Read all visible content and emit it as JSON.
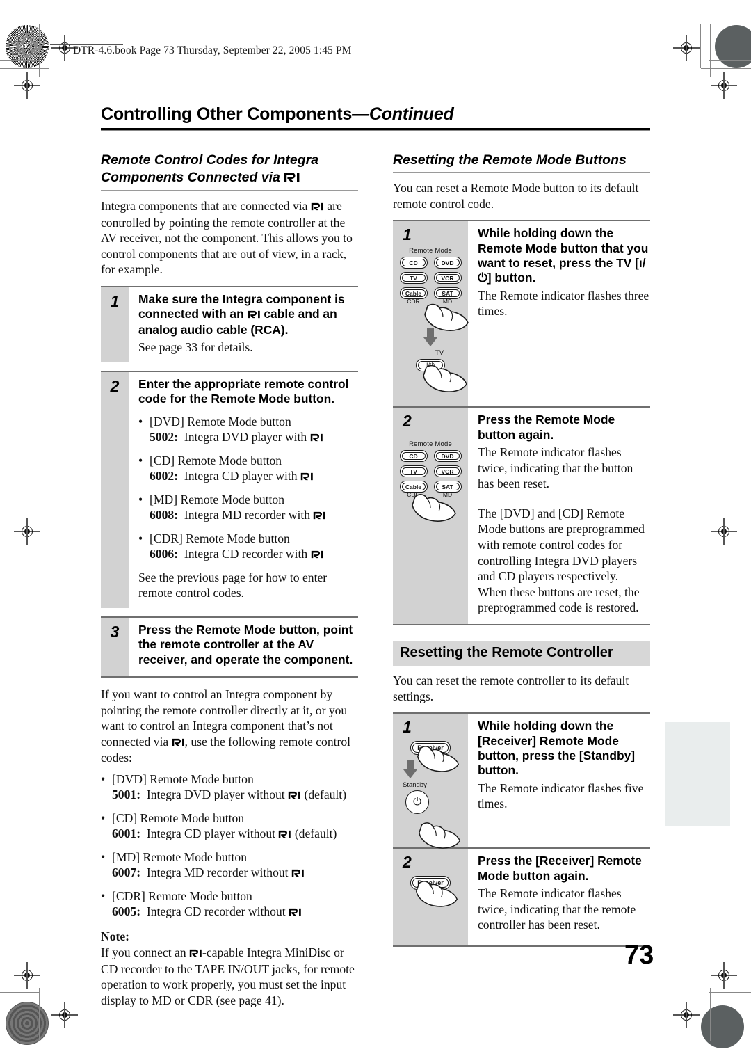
{
  "file_stamp": "DTR-4.6.book  Page 73  Thursday, September 22, 2005  1:45 PM",
  "running_head": {
    "title": "Controlling Other Components",
    "continued": "—Continued"
  },
  "page_number": "73",
  "left_column": {
    "subhead_line1": "Remote Control Codes for Integra",
    "subhead_line2_pre": "Components Connected via ",
    "intro": "Integra components that are connected via  are controlled by pointing the remote controller at the AV receiver, not the component. This allows you to control components that are out of view, in a rack, for example.",
    "steps": [
      {
        "num": "1",
        "title": "Make sure the Integra component is connected with an  cable and an analog audio cable (RCA).",
        "sub": "See page 33 for details."
      },
      {
        "num": "2",
        "title": "Enter the appropriate remote control code for the Remote Mode button.",
        "sub": ""
      },
      {
        "num": "3",
        "title": "Press the Remote Mode button, point the remote controller at the AV receiver, and operate the component.",
        "sub": ""
      }
    ],
    "codes_with_ri": [
      {
        "label": "[DVD] Remote Mode button",
        "code": "5002:",
        "desc_pre": "Integra DVD player with ",
        "desc_post": ""
      },
      {
        "label": "[CD] Remote Mode button",
        "code": "6002:",
        "desc_pre": "Integra CD player with ",
        "desc_post": ""
      },
      {
        "label": "[MD] Remote Mode button",
        "code": "6008:",
        "desc_pre": "Integra MD recorder with ",
        "desc_post": ""
      },
      {
        "label": "[CDR] Remote Mode button",
        "code": "6006:",
        "desc_pre": "Integra CD recorder with ",
        "desc_post": ""
      }
    ],
    "after_codes": "See the previous page for how to enter remote control codes.",
    "para_after_step3": "If you want to control an Integra component by pointing the remote controller directly at it, or you want to control an Integra component that’s not connected via , use the following remote control codes:",
    "codes_without_ri": [
      {
        "label": "[DVD] Remote Mode button",
        "code": "5001:",
        "desc_pre": "Integra DVD player without ",
        "desc_post": " (default)"
      },
      {
        "label": "[CD] Remote Mode button",
        "code": "6001:",
        "desc_pre": "Integra CD player without ",
        "desc_post": " (default)"
      },
      {
        "label": "[MD] Remote Mode button",
        "code": "6007:",
        "desc_pre": "Integra MD recorder without ",
        "desc_post": ""
      },
      {
        "label": "[CDR] Remote Mode button",
        "code": "6005:",
        "desc_pre": "Integra CD recorder without ",
        "desc_post": ""
      }
    ],
    "note_title": "Note:",
    "note_pre": "If you connect an ",
    "note_post": "-capable Integra MiniDisc or CD recorder to the TAPE IN/OUT jacks, for remote operation to work properly, you must set the input display to MD or CDR (see page 41)."
  },
  "right_column": {
    "section1": {
      "subhead": "Resetting the Remote Mode Buttons",
      "intro": "You can reset a Remote Mode button to its default remote control code.",
      "steps": [
        {
          "num": "1",
          "title": "While holding down the Remote Mode button that you want to reset, press the TV [ı/⏻] button.",
          "body": "The Remote indicator flashes three times."
        },
        {
          "num": "2",
          "title": "Press the Remote Mode button again.",
          "body": "The Remote indicator flashes twice, indicating that the button has been reset.",
          "body2": "The [DVD] and [CD] Remote Mode buttons are preprogrammed with remote control codes for controlling Integra DVD players and CD players respectively. When these buttons are reset, the preprogrammed code is restored."
        }
      ]
    },
    "section2": {
      "band_title": "Resetting the Remote Controller",
      "intro": "You can reset the remote controller to its default settings.",
      "steps": [
        {
          "num": "1",
          "title": "While holding down the [Receiver] Remote Mode button, press the [Standby] button.",
          "body": "The Remote indicator flashes five times."
        },
        {
          "num": "2",
          "title": "Press the [Receiver] Remote Mode button again.",
          "body": "The Remote indicator flashes twice, indicating that the remote controller has been reset."
        }
      ]
    }
  },
  "remote_diagram": {
    "group_label": "Remote Mode",
    "buttons": [
      {
        "label": "CD",
        "sub": ""
      },
      {
        "label": "DVD",
        "sub": ""
      },
      {
        "label": "TV",
        "sub": ""
      },
      {
        "label": "VCR",
        "sub": ""
      },
      {
        "label": "Cable",
        "sub": "CDR"
      },
      {
        "label": "SAT",
        "sub": "MD"
      }
    ],
    "tv_label": "TV",
    "power_label": "I/⏻",
    "receiver_label": "Receiver",
    "standby_label": "Standby"
  },
  "colors": {
    "step_band": "#d2d2d2",
    "band_head": "#d7d7d7",
    "rule": "#6f6f6f",
    "thumb_tab": "#e9eded"
  }
}
